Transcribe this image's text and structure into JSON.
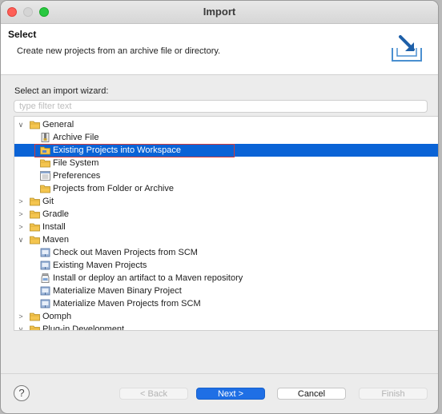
{
  "window": {
    "title": "Import"
  },
  "header": {
    "title": "Select",
    "description": "Create new projects from an archive file or directory."
  },
  "wizard": {
    "label": "Select an import wizard:",
    "filter_placeholder": "type filter text"
  },
  "tree": [
    {
      "label": "General",
      "level": 0,
      "expanded": true,
      "icon": "folder-icon"
    },
    {
      "label": "Archive File",
      "level": 1,
      "icon": "archive-file-icon"
    },
    {
      "label": "Existing Projects into Workspace",
      "level": 1,
      "icon": "projects-folder-icon",
      "selected": true
    },
    {
      "label": "File System",
      "level": 1,
      "icon": "folder-icon"
    },
    {
      "label": "Preferences",
      "level": 1,
      "icon": "preferences-icon"
    },
    {
      "label": "Projects from Folder or Archive",
      "level": 1,
      "icon": "folder-icon"
    },
    {
      "label": "Git",
      "level": 0,
      "expanded": false,
      "icon": "folder-icon"
    },
    {
      "label": "Gradle",
      "level": 0,
      "expanded": false,
      "icon": "folder-icon"
    },
    {
      "label": "Install",
      "level": 0,
      "expanded": false,
      "icon": "folder-icon"
    },
    {
      "label": "Maven",
      "level": 0,
      "expanded": true,
      "icon": "folder-icon"
    },
    {
      "label": "Check out Maven Projects from SCM",
      "level": 1,
      "icon": "maven-icon"
    },
    {
      "label": "Existing Maven Projects",
      "level": 1,
      "icon": "maven-icon"
    },
    {
      "label": "Install or deploy an artifact to a Maven repository",
      "level": 1,
      "icon": "jar-icon"
    },
    {
      "label": "Materialize Maven Binary Project",
      "level": 1,
      "icon": "maven-icon"
    },
    {
      "label": "Materialize Maven Projects from SCM",
      "level": 1,
      "icon": "maven-icon"
    },
    {
      "label": "Oomph",
      "level": 0,
      "expanded": false,
      "icon": "folder-icon"
    },
    {
      "label": "Plug-in Development",
      "level": 0,
      "expanded": true,
      "icon": "folder-icon"
    }
  ],
  "buttons": {
    "help": "?",
    "back": "< Back",
    "next": "Next >",
    "cancel": "Cancel",
    "finish": "Finish"
  },
  "colors": {
    "selection": "#0a63d6",
    "primary_button": "#1f6fe5",
    "highlight_outline": "#d33a3a"
  }
}
